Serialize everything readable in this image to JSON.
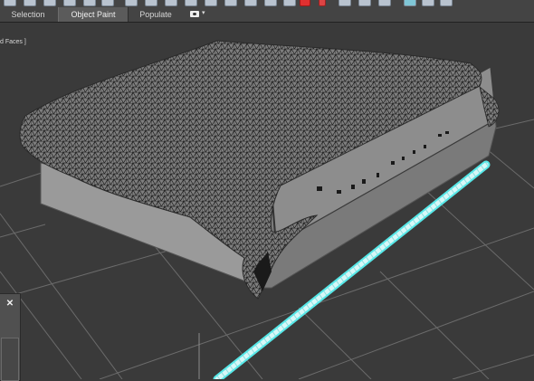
{
  "tabs": [
    {
      "label": "Selection",
      "active": false
    },
    {
      "label": "Object Paint",
      "active": true
    },
    {
      "label": "Populate",
      "active": false
    }
  ],
  "tabs_menu_icon": "viewport-display-icon",
  "viewport": {
    "label": "d Faces ]",
    "close_glyph": "✕"
  },
  "colors": {
    "ui_bg": "#444444",
    "viewport_bg": "#3a3a3a",
    "grid": "#6b6b6b",
    "wire_selected": "#5ef1f1",
    "mesh": "#8c8c8c"
  }
}
